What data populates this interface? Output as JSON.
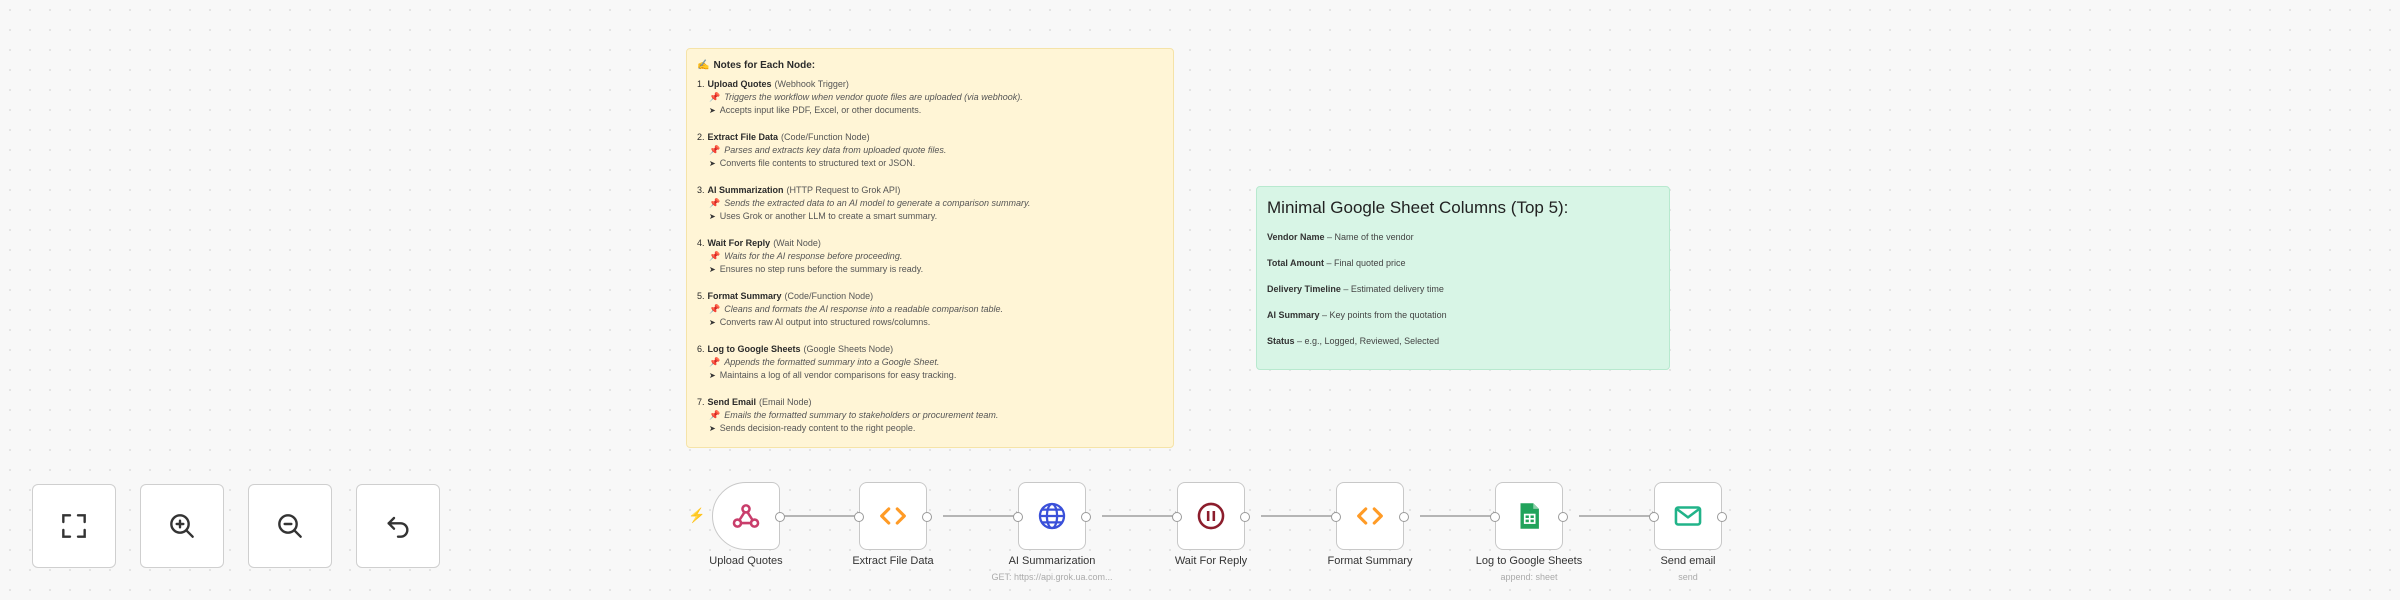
{
  "notes_panel": {
    "icon": "memo-icon",
    "title": "Notes for Each Node:",
    "steps": [
      {
        "num": "1.",
        "name": "Upload Quotes",
        "type": "(Webhook Trigger)",
        "desc": "Triggers the workflow when vendor quote files are uploaded (via webhook).",
        "detail": "Accepts input like PDF, Excel, or other documents."
      },
      {
        "num": "2.",
        "name": "Extract File Data",
        "type": "(Code/Function Node)",
        "desc": "Parses and extracts key data from uploaded quote files.",
        "detail": "Converts file contents to structured text or JSON."
      },
      {
        "num": "3.",
        "name": "AI Summarization",
        "type": "(HTTP Request to Grok API)",
        "desc": "Sends the extracted data to an AI model to generate a comparison summary.",
        "detail": "Uses Grok or another LLM to create a smart summary."
      },
      {
        "num": "4.",
        "name": "Wait For Reply",
        "type": "(Wait Node)",
        "desc": "Waits for the AI response before proceeding.",
        "detail": "Ensures no step runs before the summary is ready."
      },
      {
        "num": "5.",
        "name": "Format Summary",
        "type": "(Code/Function Node)",
        "desc": "Cleans and formats the AI response into a readable comparison table.",
        "detail": "Converts raw AI output into structured rows/columns."
      },
      {
        "num": "6.",
        "name": "Log to Google Sheets",
        "type": "(Google Sheets Node)",
        "desc": "Appends the formatted summary into a Google Sheet.",
        "detail": "Maintains a log of all vendor comparisons for easy tracking."
      },
      {
        "num": "7.",
        "name": "Send Email",
        "type": "(Email Node)",
        "desc": "Emails the formatted summary to stakeholders or procurement team.",
        "detail": "Sends decision-ready content to the right people."
      }
    ]
  },
  "columns_panel": {
    "title": "Minimal Google Sheet Columns (Top 5):",
    "rows": [
      {
        "key": "Vendor Name",
        "value": " – Name of the vendor"
      },
      {
        "key": "Total Amount",
        "value": " – Final quoted price"
      },
      {
        "key": "Delivery Timeline",
        "value": " – Estimated delivery time"
      },
      {
        "key": "AI Summary",
        "value": " – Key points from the quotation"
      },
      {
        "key": "Status",
        "value": " – e.g., Logged, Reviewed, Selected"
      }
    ]
  },
  "controls": [
    {
      "icon": "fit-view-icon"
    },
    {
      "icon": "zoom-in-icon"
    },
    {
      "icon": "zoom-out-icon"
    },
    {
      "icon": "undo-icon"
    }
  ],
  "workflow": {
    "trigger_icon": "lightning-icon",
    "nodes": [
      {
        "label": "Upload Quotes",
        "sublabel": "",
        "icon": "webhook-icon"
      },
      {
        "label": "Extract File Data",
        "sublabel": "",
        "icon": "code-icon"
      },
      {
        "label": "AI Summarization",
        "sublabel": "GET: https://api.grok.ua.com...",
        "icon": "globe-icon"
      },
      {
        "label": "Wait For Reply",
        "sublabel": "",
        "icon": "pause-icon"
      },
      {
        "label": "Format Summary",
        "sublabel": "",
        "icon": "code-icon"
      },
      {
        "label": "Log to Google Sheets",
        "sublabel": "append: sheet",
        "icon": "google-sheets-icon"
      },
      {
        "label": "Send email",
        "sublabel": "send",
        "icon": "email-icon"
      }
    ],
    "colors": {
      "code": "#ff9b26",
      "globe": "#3a50d9",
      "pause": "#8c1d2c",
      "sheets": "#21a35b",
      "email": "#21b389",
      "webhook": "#c93d6b"
    }
  }
}
